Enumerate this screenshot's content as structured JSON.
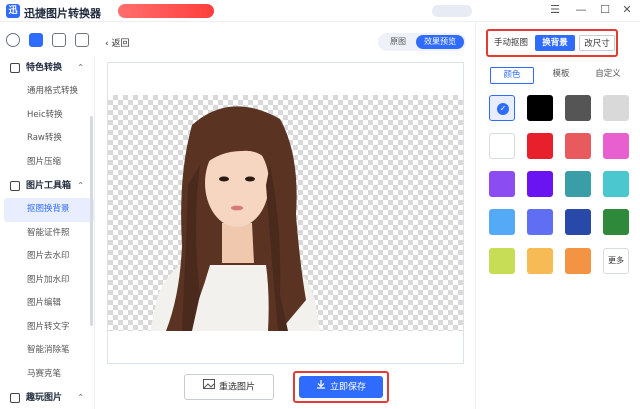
{
  "app": {
    "title": "迅捷图片转换器",
    "logo_letter": "迅"
  },
  "window_controls": {
    "menu": "☰",
    "minimize": "—",
    "maximize": "☐",
    "close": "✕"
  },
  "sidebar": {
    "groups": [
      {
        "title": "特色转换",
        "items": [
          "通用格式转换",
          "Heic转换",
          "Raw转换",
          "图片压缩"
        ]
      },
      {
        "title": "图片工具箱",
        "items": [
          "抠图换背景",
          "智能证件照",
          "图片去水印",
          "图片加水印",
          "图片编辑",
          "图片转文字",
          "智能消除笔",
          "马赛克笔"
        ]
      },
      {
        "title": "趣玩图片",
        "items": []
      }
    ],
    "active_item": "抠图换背景"
  },
  "main": {
    "back_label": "返回",
    "view_toggle": {
      "original": "原图",
      "effect": "效果预览",
      "selected": "effect"
    },
    "reselect_label": "重选图片",
    "save_label": "立即保存"
  },
  "right_panel": {
    "tabs": {
      "manual": "手动抠图",
      "replace": "换背景",
      "resize": "改尺寸",
      "selected": "replace"
    },
    "subtabs": {
      "color": "颜色",
      "template": "模板",
      "custom": "自定义",
      "selected": "color"
    },
    "more_label": "更多",
    "swatches": [
      "#e8eeff",
      "#000000",
      "#555555",
      "#d9d9d9",
      "#ffffff",
      "#e8202c",
      "#e85a5e",
      "#e85fd0",
      "#8b4df2",
      "#6a14f2",
      "#3a9ea6",
      "#4bc8cf",
      "#55aaf7",
      "#5f6ef2",
      "#2849a8",
      "#2e8a3a",
      "#c6dd55",
      "#f7bb56",
      "#f29444"
    ],
    "selected_swatch_index": 0
  },
  "colors": {
    "accent": "#2f6bff",
    "highlight": "#e53935"
  }
}
